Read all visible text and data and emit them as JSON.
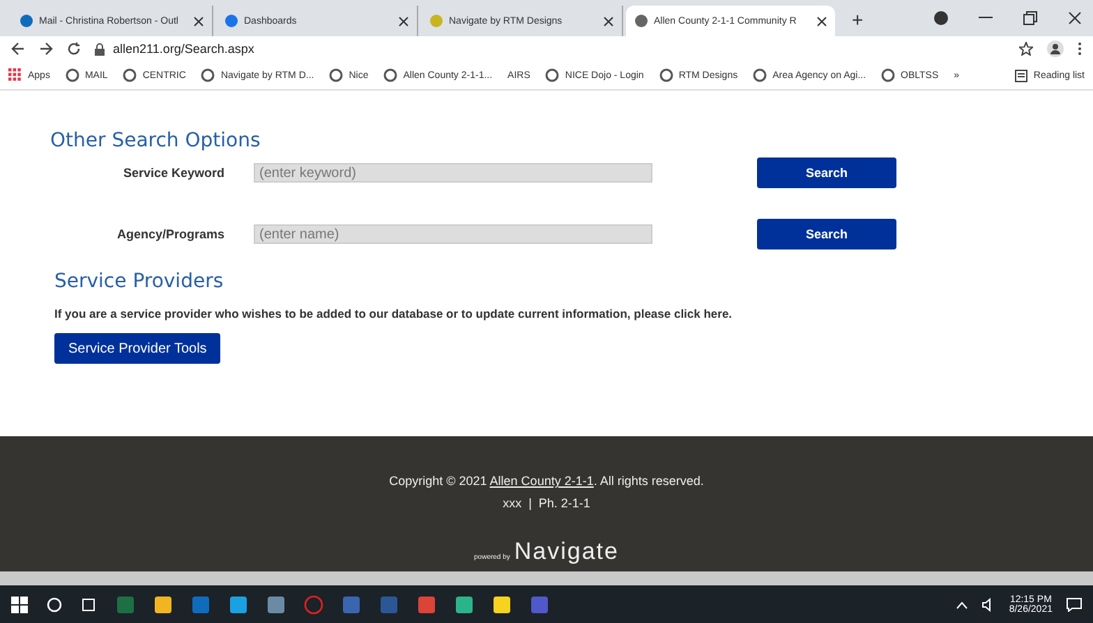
{
  "tabs": [
    {
      "title": "Mail - Christina Robertson - Outl",
      "selected": false
    },
    {
      "title": "Dashboards",
      "selected": false
    },
    {
      "title": "Navigate by RTM Designs",
      "selected": false
    },
    {
      "title": "Allen County 2-1-1 Community R",
      "selected": true
    }
  ],
  "new_tab": "+",
  "address": "allen211.org/Search.aspx",
  "bookmarks": [
    {
      "label": "Apps",
      "kind": "apps"
    },
    {
      "label": "MAIL",
      "kind": "site"
    },
    {
      "label": "CENTRIC",
      "kind": "site"
    },
    {
      "label": "Navigate by RTM D...",
      "kind": "site"
    },
    {
      "label": "Nice",
      "kind": "site"
    },
    {
      "label": "Allen County 2-1-1...",
      "kind": "site"
    },
    {
      "label": "AIRS",
      "kind": "text"
    },
    {
      "label": "NICE Dojo - Login",
      "kind": "site"
    },
    {
      "label": "RTM Designs",
      "kind": "site"
    },
    {
      "label": "Area Agency on Agi...",
      "kind": "site"
    },
    {
      "label": "OBLTSS",
      "kind": "site"
    }
  ],
  "bookmarks_more": "»",
  "reading_list": "Reading list",
  "search_heading": "Other Search Options",
  "search_rows": [
    {
      "label": "Service Keyword",
      "placeholder": "(enter keyword)",
      "button": "Search"
    },
    {
      "label": "Agency/Programs",
      "placeholder": "(enter name)",
      "button": "Search"
    }
  ],
  "providers_heading": "Service Providers",
  "providers_text": "If you are a service provider who wishes to be added to our database or to update current information, please click here.",
  "providers_button": "Service Provider Tools",
  "footer": {
    "copyright_before": "Copyright © 2021 ",
    "copyright_link": "Allen County 2-1-1",
    "copyright_after": ". All rights reserved.",
    "contact": "xxx  |  Ph. 2-1-1",
    "powered_by": "powered by",
    "brand": "Navigate"
  },
  "taskbar": {
    "apps": [
      {
        "kind": "search"
      },
      {
        "kind": "taskview"
      },
      {
        "kind": "excel"
      },
      {
        "kind": "folder"
      },
      {
        "kind": "outlook"
      },
      {
        "kind": "ie"
      },
      {
        "kind": "calc"
      },
      {
        "kind": "ring"
      },
      {
        "kind": "remote"
      },
      {
        "kind": "word"
      },
      {
        "kind": "chrome"
      },
      {
        "kind": "chat"
      },
      {
        "kind": "notes"
      },
      {
        "kind": "teams"
      }
    ],
    "time": "12:15 PM",
    "date": "8/26/2021"
  }
}
